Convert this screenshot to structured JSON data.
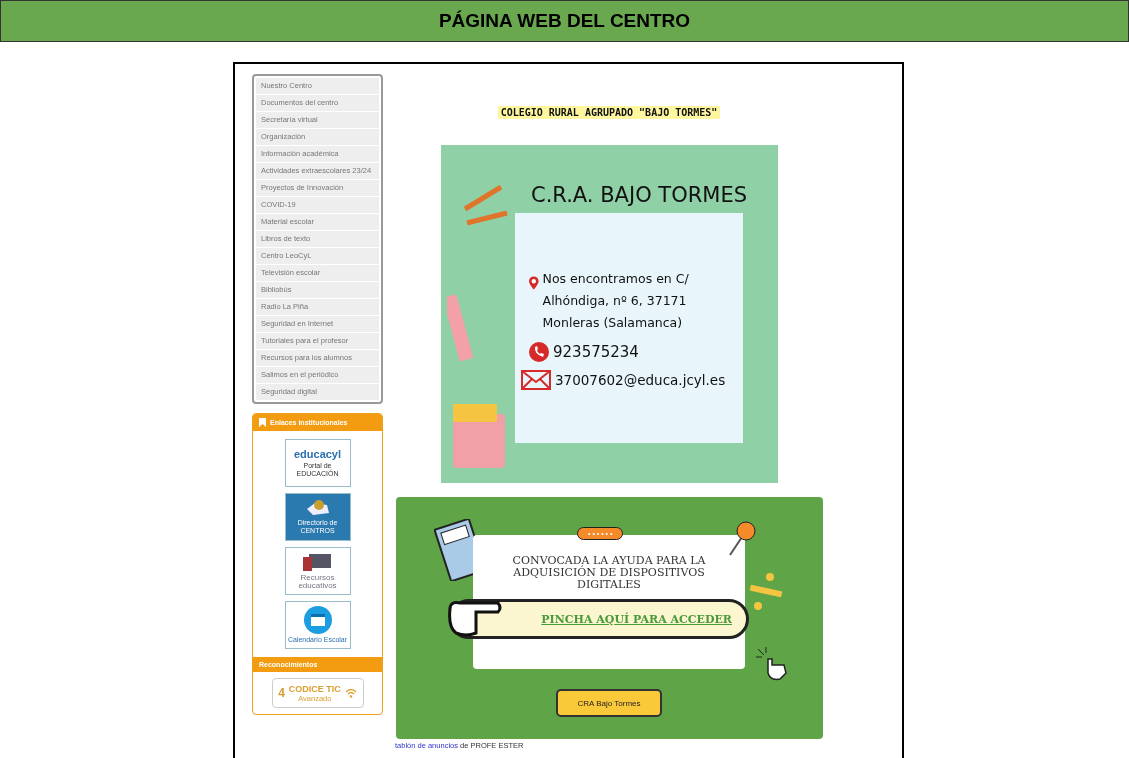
{
  "header": {
    "title": "PÁGINA WEB DEL CENTRO"
  },
  "menu": {
    "items": [
      {
        "label": "Nuestro Centro"
      },
      {
        "label": "Documentos del centro"
      },
      {
        "label": "Secretaría virtual"
      },
      {
        "label": "Organización"
      },
      {
        "label": "Información académica"
      },
      {
        "label": "Actividades extraescolares 23/24"
      },
      {
        "label": "Proyectos de Innovación"
      },
      {
        "label": "COVID-19"
      },
      {
        "label": "Material escolar"
      },
      {
        "label": "Libros de texto"
      },
      {
        "label": "Centro LeoCyL"
      },
      {
        "label": "Televisión escolar"
      },
      {
        "label": "Bibliobús"
      },
      {
        "label": "Radio La Piña"
      },
      {
        "label": "Seguridad en Internet"
      },
      {
        "label": "Tutoriales para el profesor"
      },
      {
        "label": "Recursos para los alumnos"
      },
      {
        "label": "Salimos en el periódico"
      },
      {
        "label": "Seguridad digital"
      }
    ]
  },
  "links_panel": {
    "title": "Enlaces institucionales",
    "links": [
      {
        "kind": "educacyl",
        "brand": "educacyl",
        "caption": "Portal de EDUCACIÓN"
      },
      {
        "kind": "directory",
        "caption": "Directorio de CENTROS"
      },
      {
        "kind": "resources",
        "caption": "Recursos educativos"
      },
      {
        "kind": "calendar",
        "caption": "Calendario Escolar"
      }
    ]
  },
  "recognitions": {
    "title": "Reconocimientos",
    "badge": {
      "number": "4",
      "brand": "CODICE TIC",
      "grade": "Avanzado"
    }
  },
  "main": {
    "school_title": "COLEGIO RURAL AGRUPADO \"BAJO TORMES\"",
    "poster": {
      "title": "C.R.A. BAJO TORMES",
      "address": "Nos encontramos en C/ Alhóndiga, nº 6, 37171 Monleras (Salamanca)",
      "phone": "923575234",
      "email": "37007602@educa.jcyl.es"
    },
    "banner": {
      "badge": "• • • • • •",
      "headline": "CONVOCADA LA AYUDA PARA LA ADQUISICIÓN DE DISPOSITIVOS DIGITALES",
      "cta": "PINCHA AQUÍ PARA ACCEDER",
      "button": "CRA Bajo Tormes"
    },
    "footer": {
      "link": "tablón de anuncios",
      "text": "de PROFE ESTER"
    }
  }
}
